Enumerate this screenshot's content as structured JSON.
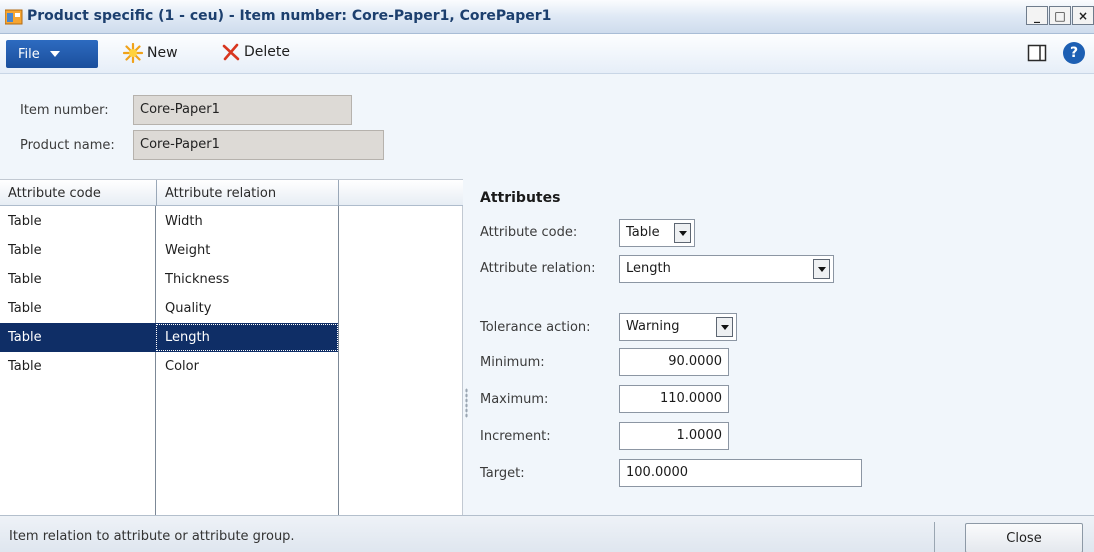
{
  "window": {
    "title": "Product specific (1 - ceu) - Item number: Core-Paper1, CorePaper1",
    "min_glyph": "_",
    "max_glyph": "□",
    "close_glyph": "×"
  },
  "toolbar": {
    "file_label": "File",
    "new_label": "New",
    "delete_label": "Delete",
    "help_glyph": "?"
  },
  "header": {
    "item_number_label": "Item number:",
    "item_number_value": "Core-Paper1",
    "product_name_label": "Product name:",
    "product_name_value": "Core-Paper1"
  },
  "grid": {
    "columns": [
      "Attribute code",
      "Attribute relation",
      ""
    ],
    "rows": [
      {
        "code": "Table",
        "relation": "Width",
        "selected": false
      },
      {
        "code": "Table",
        "relation": "Weight",
        "selected": false
      },
      {
        "code": "Table",
        "relation": "Thickness",
        "selected": false
      },
      {
        "code": "Table",
        "relation": "Quality",
        "selected": false
      },
      {
        "code": "Table",
        "relation": "Length",
        "selected": true
      },
      {
        "code": "Table",
        "relation": "Color",
        "selected": false
      }
    ]
  },
  "attributes": {
    "heading": "Attributes",
    "attribute_code_label": "Attribute code:",
    "attribute_code_value": "Table",
    "attribute_relation_label": "Attribute relation:",
    "attribute_relation_value": "Length",
    "tolerance_action_label": "Tolerance action:",
    "tolerance_action_value": "Warning",
    "minimum_label": "Minimum:",
    "minimum_value": "90.0000",
    "maximum_label": "Maximum:",
    "maximum_value": "110.0000",
    "increment_label": "Increment:",
    "increment_value": "1.0000",
    "target_label": "Target:",
    "target_value": "100.0000"
  },
  "statusbar": {
    "text": "Item relation to attribute or attribute group.",
    "close_label": "Close"
  },
  "colors": {
    "selection": "#0f2e66",
    "file_button": "#1b4f9c"
  }
}
